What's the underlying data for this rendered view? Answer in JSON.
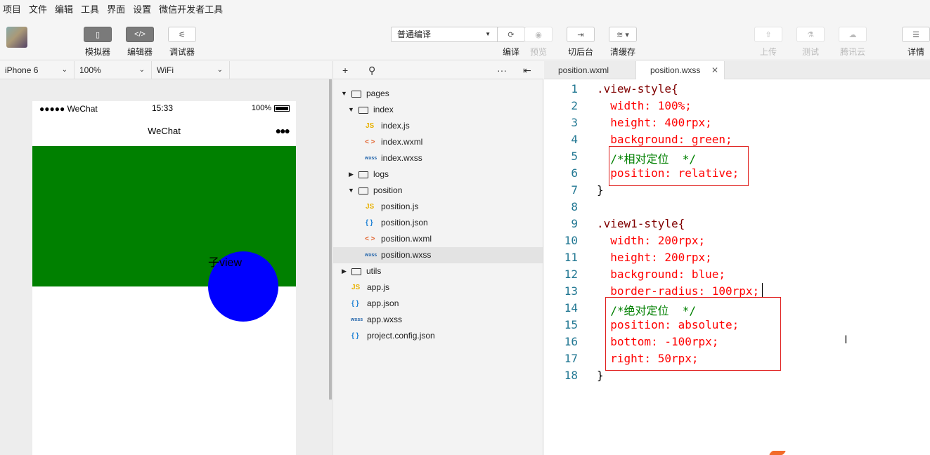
{
  "menu": [
    "项目",
    "文件",
    "编辑",
    "工具",
    "界面",
    "设置",
    "微信开发者工具"
  ],
  "toolbar": {
    "simulator": "模拟器",
    "editor": "编辑器",
    "debugger": "调试器",
    "compile_mode": "普通编译",
    "compile": "编译",
    "preview": "预览",
    "background": "切后台",
    "clear_cache": "清缓存",
    "upload": "上传",
    "test": "测试",
    "tencent_cloud": "腾讯云",
    "details": "详情"
  },
  "sim_bar": {
    "device": "iPhone 6",
    "zoom": "100%",
    "network": "WiFi"
  },
  "phone": {
    "carrier": "●●●●● WeChat",
    "time": "15:33",
    "battery": "100%",
    "nav_title": "WeChat",
    "menu_dots": "●●●",
    "child_text": "子view"
  },
  "file_tree": [
    {
      "name": "pages",
      "kind": "folder",
      "open": true
    },
    {
      "name": "index",
      "kind": "folder",
      "open": true
    },
    {
      "name": "index.js",
      "kind": "js"
    },
    {
      "name": "index.wxml",
      "kind": "wxml"
    },
    {
      "name": "index.wxss",
      "kind": "wxss"
    },
    {
      "name": "logs",
      "kind": "folder",
      "open": false
    },
    {
      "name": "position",
      "kind": "folder",
      "open": true
    },
    {
      "name": "position.js",
      "kind": "js"
    },
    {
      "name": "position.json",
      "kind": "json"
    },
    {
      "name": "position.wxml",
      "kind": "wxml"
    },
    {
      "name": "position.wxss",
      "kind": "wxss",
      "selected": true
    },
    {
      "name": "utils",
      "kind": "folder",
      "open": false
    },
    {
      "name": "app.js",
      "kind": "js"
    },
    {
      "name": "app.json",
      "kind": "json"
    },
    {
      "name": "app.wxss",
      "kind": "wxss"
    },
    {
      "name": "project.config.json",
      "kind": "json"
    }
  ],
  "icons": {
    "js": "JS",
    "wxml": "< >",
    "wxss": "wxss",
    "json": "{ }"
  },
  "tabs": [
    {
      "label": "position.wxml",
      "active": false
    },
    {
      "label": "position.wxss",
      "active": true,
      "close": "✕"
    }
  ],
  "code_lines": [
    ".view-style{",
    "  width: 100%;",
    "  height: 400rpx;",
    "  background: green;",
    "  /*相对定位  */",
    "  position: relative;",
    "}",
    "",
    ".view1-style{",
    "  width: 200rpx;",
    "  height: 200rpx;",
    "  background: blue;",
    "  border-radius: 100rpx;",
    "  /*绝对定位  */",
    "  position: absolute;",
    "  bottom: -100rpx;",
    "  right: 50rpx;",
    "}"
  ],
  "colors": {
    "green_view": "#008000",
    "blue_view": "#0000ff",
    "highlight_box": "#e0201e"
  }
}
